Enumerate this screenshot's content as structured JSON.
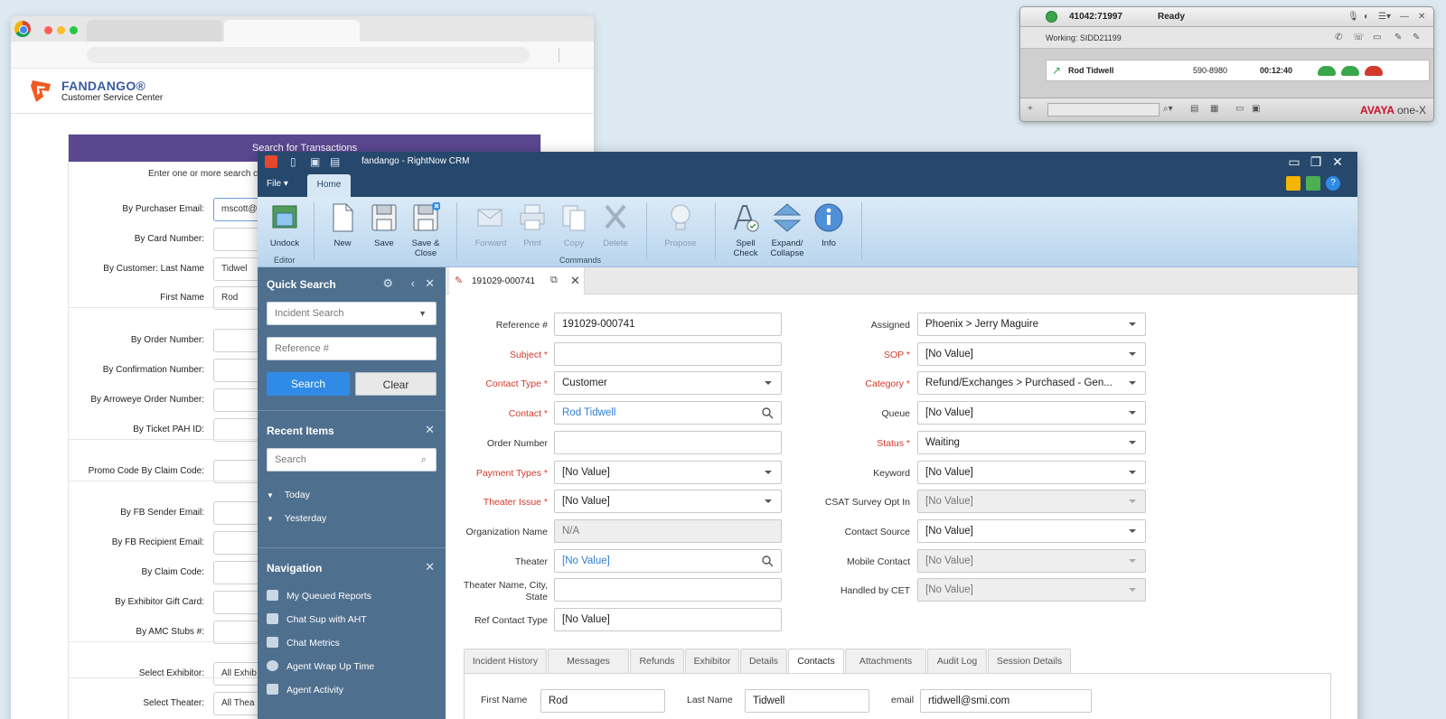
{
  "fandango": {
    "brand": "FANDANGO®",
    "subtitle": "Customer Service Center",
    "search_title": "Search for Transactions",
    "intro": "Enter one or more search c",
    "rows": [
      {
        "label": "By Purchaser Email:",
        "value": "mscott@"
      },
      {
        "label": "By Card Number:",
        "value": ""
      },
      {
        "label": "By Customer: Last Name",
        "value": "Tidwel"
      },
      {
        "label": "First Name",
        "value": "Rod"
      },
      {
        "label": "By Order Number:",
        "value": ""
      },
      {
        "label": "By Confirmation Number:",
        "value": ""
      },
      {
        "label": "By Arroweye Order Number:",
        "value": ""
      },
      {
        "label": "By Ticket PAH ID:",
        "value": ""
      },
      {
        "label": "Promo Code By Claim Code:",
        "value": ""
      },
      {
        "label": "By FB Sender Email:",
        "value": ""
      },
      {
        "label": "By FB Recipient Email:",
        "value": ""
      },
      {
        "label": "By Claim Code:",
        "value": ""
      },
      {
        "label": "By Exhibitor Gift Card:",
        "value": ""
      },
      {
        "label": "By AMC Stubs #:",
        "value": ""
      },
      {
        "label": "Select Exhibitor:",
        "value": "All Exhib"
      },
      {
        "label": "Select Theater:",
        "value": "All Thea"
      }
    ]
  },
  "avaya": {
    "extension": "41042:71997",
    "status": "Ready",
    "working": "Working: SIDD21199",
    "caller": "Rod Tidwell",
    "number": "590-8980",
    "duration": "00:12:40",
    "brand_a": "AVAYA",
    "brand_b": "one-X",
    "colors": {
      "green": "#3aa64b",
      "red": "#d23a2b",
      "brand": "#c8102e"
    }
  },
  "crm": {
    "title": "fandango - RightNow CRM",
    "menu_file": "File",
    "menu_home": "Home",
    "ribbon": {
      "undock": "Undock",
      "editor_group": "Editor",
      "new": "New",
      "save": "Save",
      "save_close": "Save & Close",
      "forward": "Forward",
      "print": "Print",
      "copy": "Copy",
      "delete": "Delete",
      "commands_group": "Commands",
      "propose": "Propose",
      "spell_check": "Spell Check",
      "expand_collapse": "Expand/ Collapse",
      "info": "Info"
    },
    "quick_search": {
      "title": "Quick Search",
      "type": "Incident Search",
      "reference_placeholder": "Reference #",
      "search_btn": "Search",
      "clear_btn": "Clear"
    },
    "recent": {
      "title": "Recent Items",
      "search_placeholder": "Search",
      "groups": [
        "Today",
        "Yesterday"
      ]
    },
    "navigation": {
      "title": "Navigation",
      "items": [
        "My Queued Reports",
        "Chat Sup with AHT",
        "Chat Metrics",
        "Agent Wrap Up Time",
        "Agent Activity"
      ]
    },
    "doc_tab": "191029-000741",
    "left_fields": [
      {
        "label": "Reference #",
        "value": "191029-000741",
        "required": false
      },
      {
        "label": "Subject *",
        "value": "",
        "required": true
      },
      {
        "label": "Contact Type *",
        "value": "Customer",
        "required": true
      },
      {
        "label": "Contact *",
        "value": "Rod Tidwell",
        "required": true
      },
      {
        "label": "Order Number",
        "value": "",
        "required": false
      },
      {
        "label": "Payment Types *",
        "value": "[No Value]",
        "required": true
      },
      {
        "label": "Theater Issue *",
        "value": "[No Value]",
        "required": true
      },
      {
        "label": "Organization Name",
        "value": "N/A",
        "required": false
      },
      {
        "label": "Theater",
        "value": "[No Value]",
        "required": false
      },
      {
        "label": "Theater Name, City, State",
        "value": "",
        "required": false
      },
      {
        "label": "Ref Contact Type",
        "value": "[No Value]",
        "required": false
      }
    ],
    "right_fields": [
      {
        "label": "Assigned",
        "value": "Phoenix > Jerry Maguire"
      },
      {
        "label": "SOP *",
        "value": "[No Value]"
      },
      {
        "label": "Category *",
        "value": "Refund/Exchanges > Purchased - Gen..."
      },
      {
        "label": "Queue",
        "value": "[No Value]"
      },
      {
        "label": "Status *",
        "value": "Waiting"
      },
      {
        "label": "Keyword",
        "value": "[No Value]"
      },
      {
        "label": "CSAT Survey Opt In",
        "value": "[No Value]"
      },
      {
        "label": "Contact Source",
        "value": "[No Value]"
      },
      {
        "label": "Mobile Contact",
        "value": "[No Value]"
      },
      {
        "label": "Handled by CET",
        "value": "[No Value]"
      }
    ],
    "subtabs": [
      "Incident History",
      "Messages",
      "Refunds",
      "Exhibitor",
      "Details",
      "Contacts",
      "Attachments",
      "Audit Log",
      "Session Details"
    ],
    "active_subtab": "Contacts",
    "contact_panel": {
      "first_name_label": "First Name",
      "first_name": "Rod",
      "last_name_label": "Last Name",
      "last_name": "Tidwell",
      "email_label": "email",
      "email": "rtidwell@smi.com"
    },
    "colors": {
      "titlebar": "#26486c",
      "sidebar": "#4f6f8e",
      "accent": "#2f8be6",
      "required": "#d23a2b"
    }
  }
}
